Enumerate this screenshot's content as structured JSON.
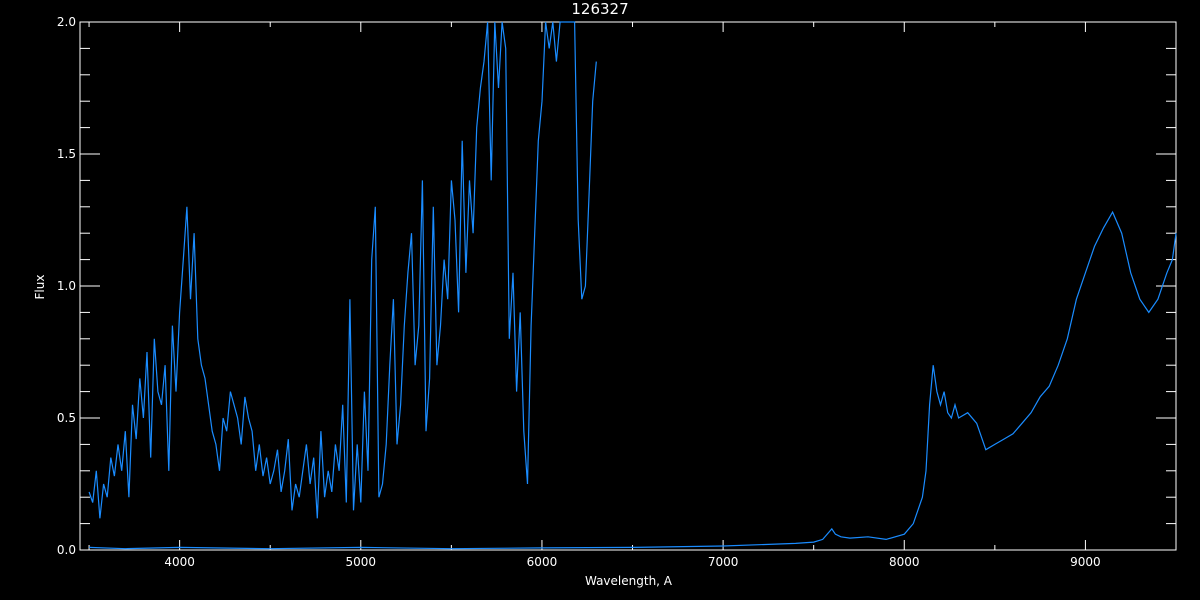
{
  "chart_data": {
    "type": "line",
    "title": "126327",
    "xlabel": "Wavelength, A",
    "ylabel": "Flux",
    "xlim": [
      3450,
      9500
    ],
    "ylim": [
      0,
      2.0
    ],
    "x_ticks": [
      4000,
      5000,
      6000,
      7000,
      8000,
      9000
    ],
    "x_tick_labels": [
      "4000",
      "5000",
      "6000",
      "7000",
      "8000",
      "9000"
    ],
    "y_ticks": [
      0,
      0.5,
      1.0,
      1.5,
      2.0
    ],
    "y_tick_labels": [
      "0.0",
      "0.5",
      "1.0",
      "1.5",
      "2.0"
    ],
    "grid": false,
    "line_color": "#1a8cff",
    "background": "#000000",
    "axes_color": "#ffffff",
    "series": [
      {
        "x": [
          3500,
          3520,
          3540,
          3560,
          3580,
          3600,
          3620,
          3640,
          3660,
          3680,
          3700,
          3720,
          3740,
          3760,
          3780,
          3800,
          3820,
          3840,
          3860,
          3880,
          3900,
          3920,
          3940,
          3960,
          3980,
          4000,
          4020,
          4040,
          4060,
          4080,
          4100,
          4120,
          4140,
          4160,
          4180,
          4200,
          4220,
          4240,
          4260,
          4280,
          4300,
          4320,
          4340,
          4360,
          4380,
          4400,
          4420,
          4440,
          4460,
          4480,
          4500,
          4520,
          4540,
          4560,
          4580,
          4600,
          4620,
          4640,
          4660,
          4680,
          4700,
          4720,
          4740,
          4760,
          4780,
          4800,
          4820,
          4840,
          4860,
          4880,
          4900,
          4920,
          4940,
          4960,
          4980,
          5000,
          5020,
          5040,
          5060,
          5080,
          5100,
          5120,
          5140,
          5160,
          5180,
          5200,
          5220,
          5240,
          5260,
          5280,
          5300,
          5320,
          5340,
          5360,
          5380,
          5400,
          5420,
          5440,
          5460,
          5480,
          5500,
          5520,
          5540,
          5560,
          5580,
          5600,
          5620,
          5640,
          5660,
          5680,
          5700,
          5720,
          5740,
          5760,
          5780,
          5800,
          5820,
          5840,
          5860,
          5880,
          5900,
          5920,
          5940,
          5960,
          5980,
          6000,
          6020,
          6040,
          6060,
          6080,
          6100,
          6120,
          6140,
          6160,
          6180,
          6200,
          6220,
          6240,
          6260,
          6280,
          6300
        ],
        "y": [
          0.22,
          0.18,
          0.3,
          0.12,
          0.25,
          0.2,
          0.35,
          0.28,
          0.4,
          0.3,
          0.45,
          0.2,
          0.55,
          0.42,
          0.65,
          0.5,
          0.75,
          0.35,
          0.8,
          0.6,
          0.55,
          0.7,
          0.3,
          0.85,
          0.6,
          0.9,
          1.1,
          1.3,
          0.95,
          1.2,
          0.8,
          0.7,
          0.65,
          0.55,
          0.45,
          0.4,
          0.3,
          0.5,
          0.45,
          0.6,
          0.55,
          0.5,
          0.4,
          0.58,
          0.5,
          0.45,
          0.3,
          0.4,
          0.28,
          0.35,
          0.25,
          0.3,
          0.38,
          0.22,
          0.3,
          0.42,
          0.15,
          0.25,
          0.2,
          0.3,
          0.4,
          0.25,
          0.35,
          0.12,
          0.45,
          0.2,
          0.3,
          0.22,
          0.4,
          0.3,
          0.55,
          0.18,
          0.95,
          0.15,
          0.4,
          0.18,
          0.6,
          0.3,
          1.1,
          1.3,
          0.2,
          0.25,
          0.4,
          0.7,
          0.95,
          0.4,
          0.55,
          0.85,
          1.05,
          1.2,
          0.7,
          0.85,
          1.4,
          0.45,
          0.65,
          1.3,
          0.7,
          0.85,
          1.1,
          0.95,
          1.4,
          1.25,
          0.9,
          1.55,
          1.05,
          1.4,
          1.2,
          1.6,
          1.75,
          1.85,
          2.0,
          1.4,
          2.0,
          1.75,
          2.0,
          1.9,
          0.8,
          1.05,
          0.6,
          0.9,
          0.45,
          0.25,
          0.85,
          1.2,
          1.55,
          1.7,
          2.0,
          1.9,
          2.0,
          1.85,
          2.0,
          2.0,
          2.0,
          2.0,
          2.0,
          1.25,
          0.95,
          1.0,
          1.35,
          1.7,
          1.85
        ]
      },
      {
        "x": [
          3500,
          3700,
          4000,
          4500,
          5000,
          5500,
          6000,
          6500,
          7000,
          7200,
          7400,
          7500,
          7550,
          7600,
          7620,
          7650,
          7700,
          7800,
          7900,
          8000,
          8050,
          8100,
          8120,
          8140,
          8160,
          8180,
          8200,
          8220,
          8240,
          8260,
          8280,
          8300,
          8350,
          8400,
          8440,
          8450,
          8500,
          8550,
          8600,
          8650,
          8700,
          8750,
          8800,
          8850,
          8900,
          8950,
          9000,
          9050,
          9100,
          9150,
          9200,
          9250,
          9300,
          9350,
          9400,
          9450,
          9480,
          9500
        ],
        "y": [
          0.01,
          0.005,
          0.01,
          0.005,
          0.01,
          0.005,
          0.008,
          0.01,
          0.015,
          0.02,
          0.025,
          0.03,
          0.04,
          0.08,
          0.06,
          0.05,
          0.045,
          0.05,
          0.04,
          0.06,
          0.1,
          0.2,
          0.3,
          0.55,
          0.7,
          0.6,
          0.55,
          0.6,
          0.52,
          0.5,
          0.55,
          0.5,
          0.52,
          0.48,
          0.4,
          0.38,
          0.4,
          0.42,
          0.44,
          0.48,
          0.52,
          0.58,
          0.62,
          0.7,
          0.8,
          0.95,
          1.05,
          1.15,
          1.22,
          1.28,
          1.2,
          1.05,
          0.95,
          0.9,
          0.95,
          1.05,
          1.1,
          1.2
        ]
      }
    ]
  }
}
